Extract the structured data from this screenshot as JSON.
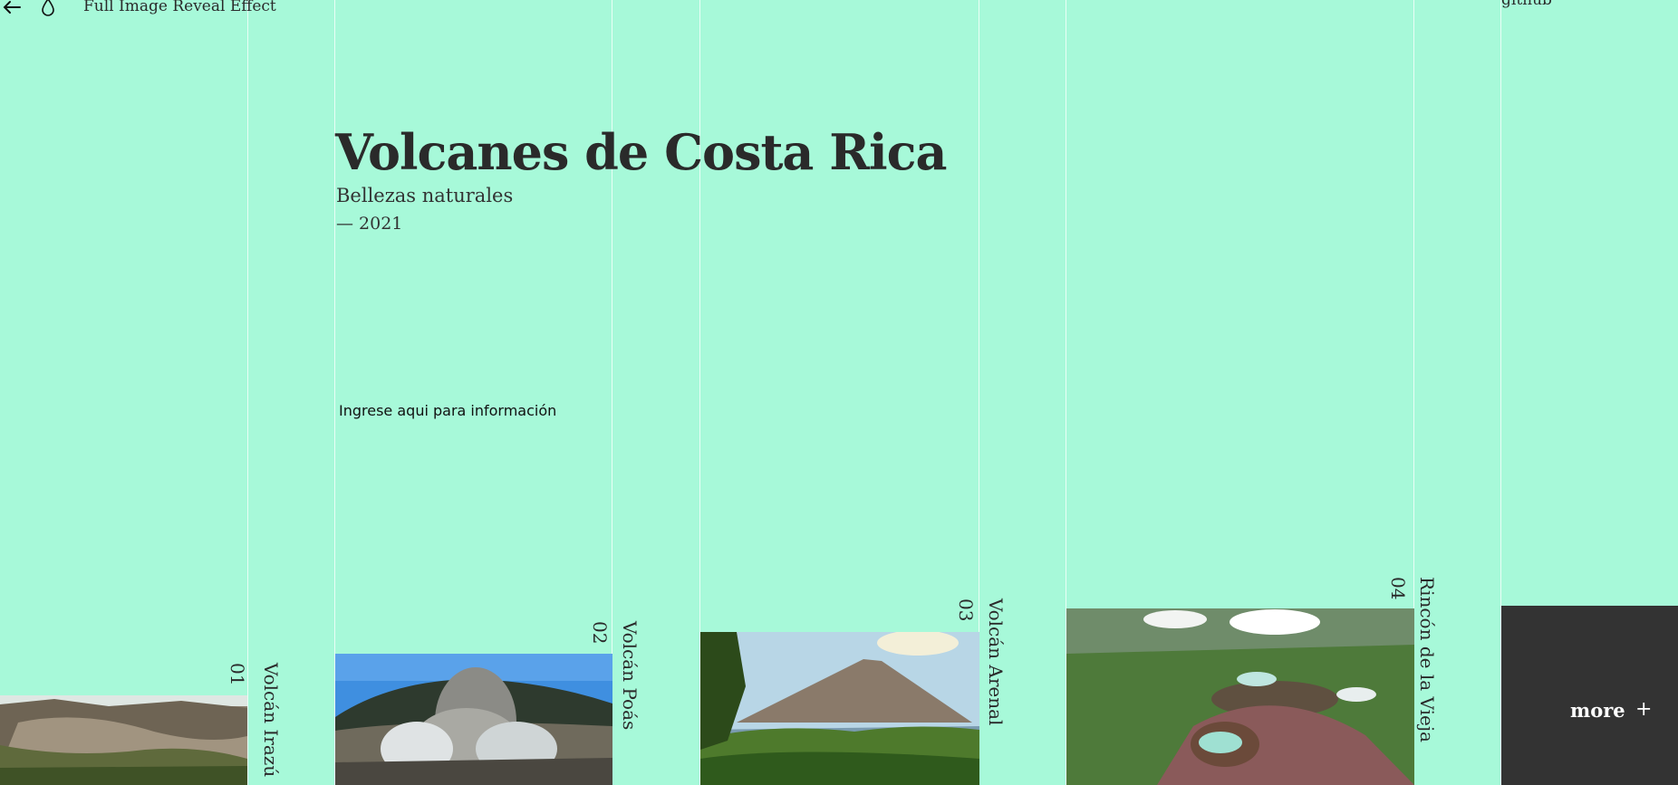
{
  "header": {
    "back_icon": "arrow-left-icon",
    "drop_icon": "drop-icon",
    "demo_title": "Full Image Reveal Effect",
    "github_label": "github"
  },
  "hero": {
    "title": "Volcanes de Costa Rica",
    "subtitle": "Bellezas naturales",
    "year": "— 2021",
    "info_link": "Ingrese aqui para información"
  },
  "items": [
    {
      "number": "01",
      "name": "Volcán Irazú"
    },
    {
      "number": "02",
      "name": "Volcán Poás"
    },
    {
      "number": "03",
      "name": "Volcán Arenal"
    },
    {
      "number": "04",
      "name": "Rincón de la Vieja"
    }
  ],
  "more": {
    "label": "more",
    "icon": "plus-icon"
  },
  "colors": {
    "background": "#a7f9d9",
    "text": "#2a2a2a",
    "more_box": "#333333"
  }
}
